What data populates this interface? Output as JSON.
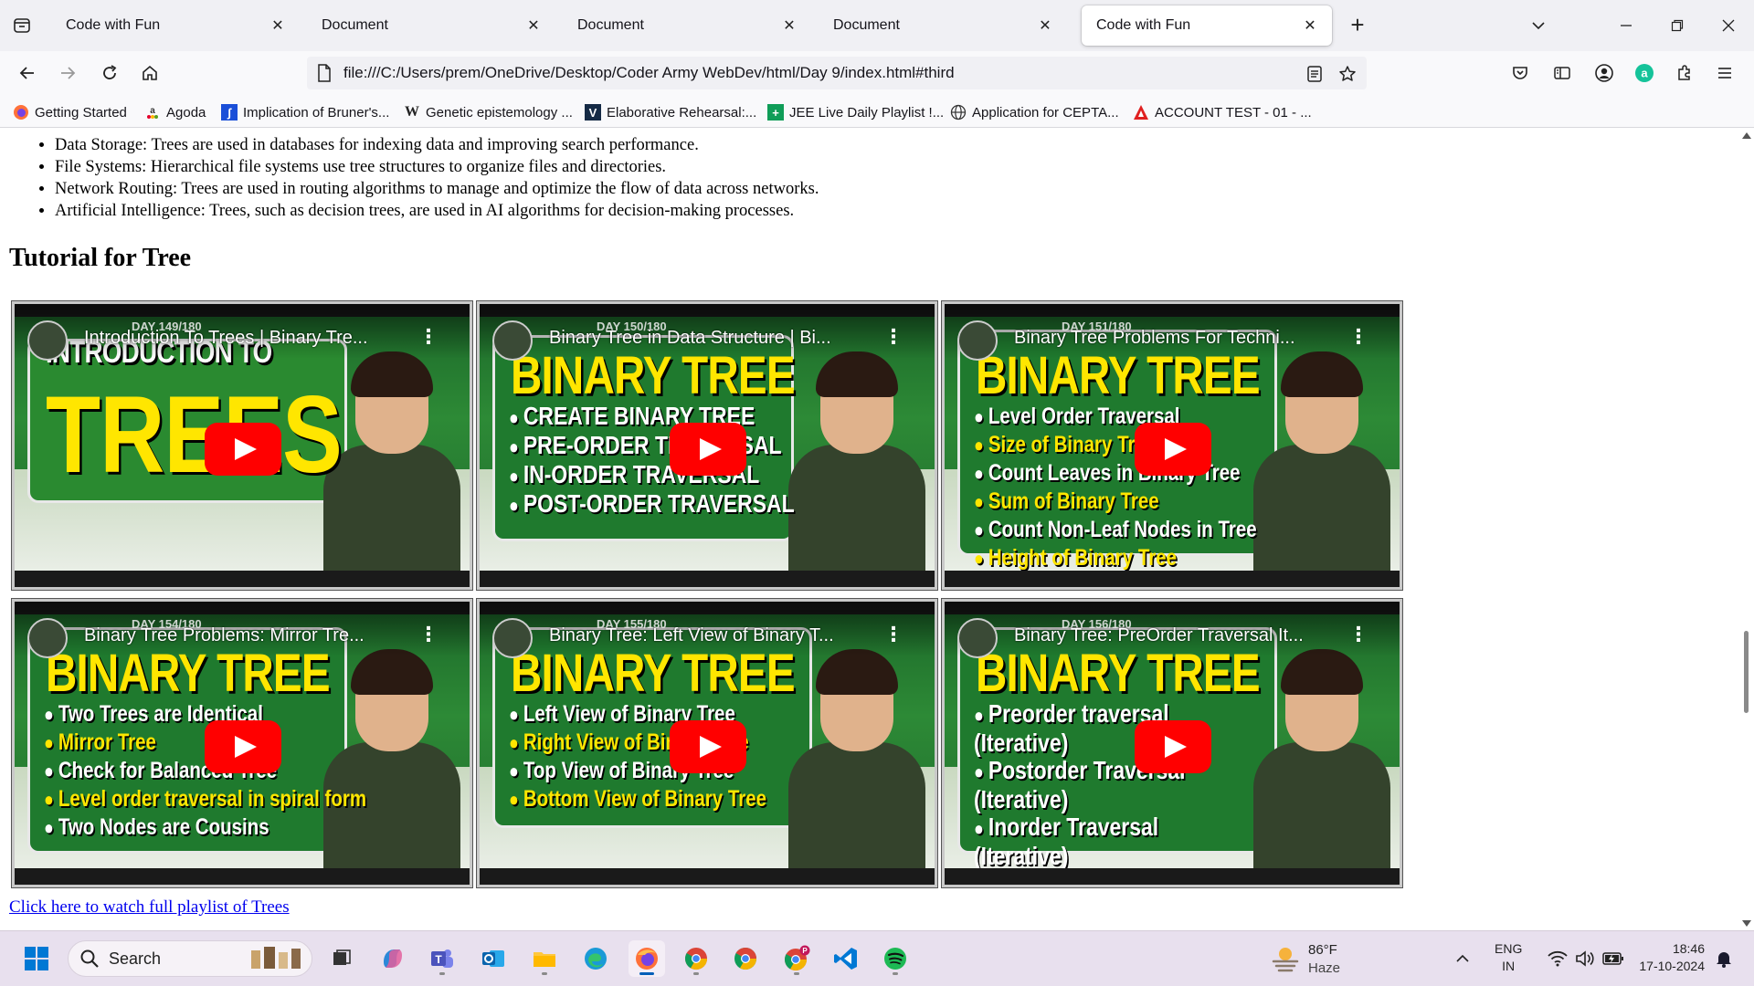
{
  "browser": {
    "tabs": [
      {
        "title": "Code with Fun",
        "active": false
      },
      {
        "title": "Document",
        "active": false
      },
      {
        "title": "Document",
        "active": false
      },
      {
        "title": "Document",
        "active": false
      },
      {
        "title": "Code with Fun",
        "active": true
      }
    ],
    "close_glyph": "✕",
    "new_tab_glyph": "+",
    "url": "file:///C:/Users/prem/OneDrive/Desktop/Coder Army WebDev/html/Day 9/index.html#third",
    "bookmarks": [
      {
        "label": "Getting Started",
        "icon": "firefox-icon"
      },
      {
        "label": "Agoda",
        "icon": "agoda-icon"
      },
      {
        "label": "Implication of Bruner's...",
        "icon": "bookmark-doc-icon"
      },
      {
        "label": "Genetic epistemology ...",
        "icon": "wikipedia-icon"
      },
      {
        "label": "Elaborative Rehearsal:...",
        "icon": "verywell-icon"
      },
      {
        "label": "JEE Live Daily Playlist !...",
        "icon": "sheets-icon"
      },
      {
        "label": "Application for CEPTA...",
        "icon": "globe-icon"
      },
      {
        "label": "ACCOUNT TEST - 01 - ...",
        "icon": "account-test-icon"
      }
    ]
  },
  "page": {
    "bullets": [
      "Data Storage: Trees are used in databases for indexing data and improving search performance.",
      "File Systems: Hierarchical file systems use tree structures to organize files and directories.",
      "Network Routing: Trees are used in routing algorithms to manage and optimize the flow of data across networks.",
      "Artificial Intelligence: Trees, such as decision trees, are used in AI algorithms for decision-making processes."
    ],
    "heading": "Tutorial for Tree",
    "videos": [
      {
        "title": "Introduction To Trees | Binary Tre...",
        "day": "DAY 149/180",
        "thumb_heading": "INTRODUCTION TO",
        "thumb_big": "TREES",
        "topics": []
      },
      {
        "title": "Binary Tree in Data Structure | Bi...",
        "day": "DAY 150/180",
        "thumb_heading": "BINARY TREE",
        "thumb_big": "",
        "topics": [
          {
            "text": "CREATE BINARY TREE",
            "highlight": false
          },
          {
            "text": "PRE-ORDER TRAVERSAL",
            "highlight": false
          },
          {
            "text": "IN-ORDER TRAVERSAL",
            "highlight": false
          },
          {
            "text": "POST-ORDER TRAVERSAL",
            "highlight": false
          }
        ]
      },
      {
        "title": "Binary Tree Problems For Techni...",
        "day": "DAY 151/180",
        "thumb_heading": "BINARY TREE",
        "thumb_big": "",
        "topics": [
          {
            "text": "Level Order Traversal",
            "highlight": false
          },
          {
            "text": "Size of Binary Tree",
            "highlight": true
          },
          {
            "text": "Count Leaves in Binary Tree",
            "highlight": false
          },
          {
            "text": "Sum of Binary Tree",
            "highlight": true
          },
          {
            "text": "Count Non-Leaf Nodes in Tree",
            "highlight": false
          },
          {
            "text": "Height of Binary Tree",
            "highlight": true
          }
        ]
      },
      {
        "title": "Binary Tree Problems: Mirror Tre...",
        "day": "DAY 154/180",
        "thumb_heading": "BINARY TREE",
        "thumb_big": "",
        "topics": [
          {
            "text": "Two Trees are Identical",
            "highlight": false
          },
          {
            "text": "Mirror Tree",
            "highlight": true
          },
          {
            "text": "Check for Balanced Tree",
            "highlight": false
          },
          {
            "text": "Level order traversal in spiral form",
            "highlight": true
          },
          {
            "text": "Two Nodes are Cousins",
            "highlight": false
          }
        ]
      },
      {
        "title": "Binary Tree: Left View of Binary T...",
        "day": "DAY 155/180",
        "thumb_heading": "BINARY TREE",
        "thumb_big": "",
        "topics": [
          {
            "text": "Left View of Binary Tree",
            "highlight": false
          },
          {
            "text": "Right View of Binary Tree",
            "highlight": true
          },
          {
            "text": "Top View of Binary Tree",
            "highlight": false
          },
          {
            "text": "Bottom View of Binary Tree",
            "highlight": true
          }
        ]
      },
      {
        "title": "Binary Tree: PreOrder Traversal It...",
        "day": "DAY 156/180",
        "thumb_heading": "BINARY TREE",
        "thumb_big": "",
        "topics": [
          {
            "text": "Preorder traversal (Iterative)",
            "highlight": false
          },
          {
            "text": "Postorder Traversal (Iterative)",
            "highlight": false
          },
          {
            "text": "Inorder Traversal (Iterative)",
            "highlight": false
          }
        ]
      }
    ],
    "kebab_glyph": "⋮",
    "playlist_link": "Click here to watch full playlist of Trees"
  },
  "taskbar": {
    "search_label": "Search",
    "apps": [
      "start-icon",
      "task-view-icon",
      "copilot-icon",
      "teams-icon",
      "outlook-icon",
      "file-explorer-icon",
      "edge-icon",
      "firefox-icon",
      "chrome-icon",
      "chrome-profile-icon",
      "chrome-profile-p-icon",
      "vscode-icon",
      "spotify-icon"
    ],
    "weather_temp": "86°F",
    "weather_cond": "Haze",
    "lang_line1": "ENG",
    "lang_line2": "IN",
    "time": "18:46",
    "date": "17-10-2024"
  }
}
